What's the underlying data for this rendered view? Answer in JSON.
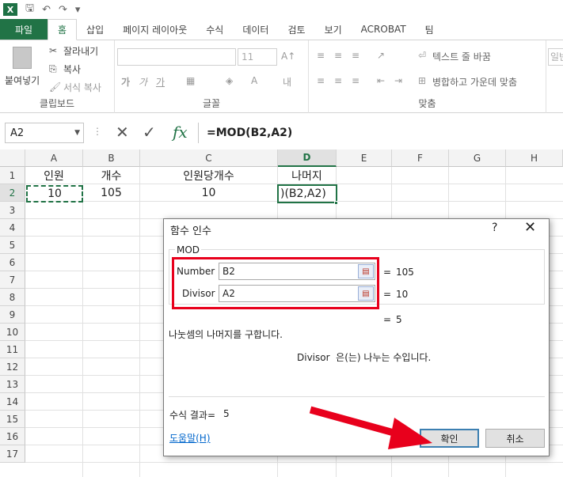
{
  "app": {
    "logo": "X"
  },
  "qat": {
    "save_icon": "save-icon",
    "undo_icon": "undo-icon",
    "redo_icon": "redo-icon"
  },
  "tabs": [
    {
      "label": "파일"
    },
    {
      "label": "홈"
    },
    {
      "label": "삽입"
    },
    {
      "label": "페이지 레이아웃"
    },
    {
      "label": "수식"
    },
    {
      "label": "데이터"
    },
    {
      "label": "검토"
    },
    {
      "label": "보기"
    },
    {
      "label": "ACROBAT"
    },
    {
      "label": "팀"
    }
  ],
  "ribbon": {
    "clipboard": {
      "paste": "붙여넣기",
      "cut": "잘라내기",
      "copy": "복사",
      "format_painter": "서식 복사",
      "label": "클립보드"
    },
    "font": {
      "size": "11",
      "label": "글꼴",
      "bold": "가",
      "italic": "가",
      "underline": "가"
    },
    "alignment": {
      "wrap_text": "텍스트 줄 바꿈",
      "merge_center": "병합하고 가운데 맞춤",
      "label": "맞춤"
    },
    "number": {
      "format": "일반"
    }
  },
  "formula_bar": {
    "name_box": "A2",
    "cancel": "✕",
    "enter": "✓",
    "fx": "fx",
    "formula": "=MOD(B2,A2)"
  },
  "grid": {
    "columns": [
      "A",
      "B",
      "C",
      "D",
      "E",
      "F",
      "G",
      "H"
    ],
    "rows": [
      "1",
      "2",
      "3",
      "4",
      "5",
      "6",
      "7",
      "8",
      "9",
      "10",
      "11",
      "12",
      "13",
      "14",
      "15",
      "16",
      "17"
    ],
    "row1": {
      "A": "인원",
      "B": "개수",
      "C": "인원당개수",
      "D": "나머지"
    },
    "row2": {
      "A": "10",
      "B": "105",
      "C": "10",
      "D": ")(B2,A2)"
    }
  },
  "dialog": {
    "title": "함수 인수",
    "help_icon": "?",
    "close_icon": "✕",
    "function_name": "MOD",
    "args": [
      {
        "label": "Number",
        "value": "B2",
        "result": "105"
      },
      {
        "label": "Divisor",
        "value": "A2",
        "result": "10"
      }
    ],
    "eq": "=",
    "overall_result": "5",
    "description": "나눗셈의 나머지를 구합니다.",
    "arg_description": "Divisor  은(는) 나누는 수입니다.",
    "formula_result_label": "수식 결과=",
    "formula_result_value": "5",
    "help_link": "도움말(H)",
    "ok": "확인",
    "cancel": "취소"
  },
  "colors": {
    "excel_green": "#217346",
    "highlight_red": "#e8001c"
  }
}
